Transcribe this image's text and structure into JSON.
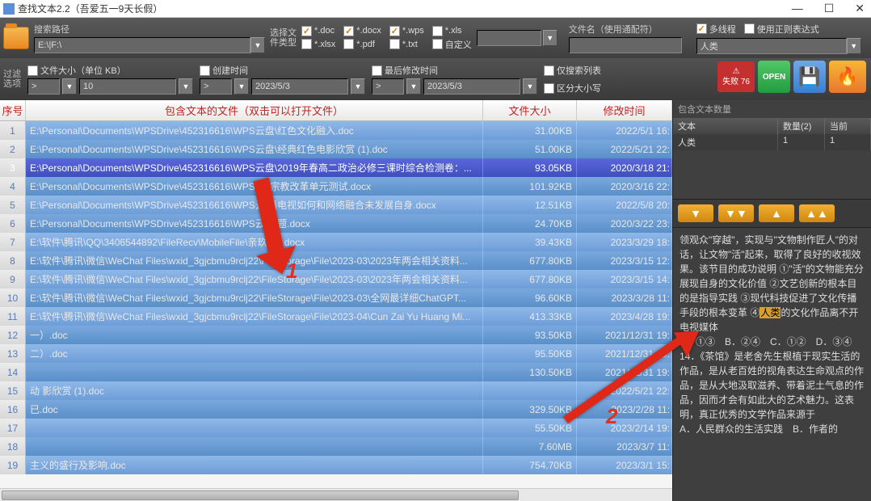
{
  "window": {
    "title": "查找文本2.2（吾爱五一9天长假）"
  },
  "toolbar": {
    "path_label": "搜索路径",
    "path_value": "E:\\|F:\\",
    "filetype_label": "选择文\n件类型",
    "filetypes": [
      {
        "label": "*.doc",
        "checked": true
      },
      {
        "label": "*.docx",
        "checked": true
      },
      {
        "label": "*.wps",
        "checked": true
      },
      {
        "label": "*.xls",
        "checked": false
      },
      {
        "label": "*.xlsx",
        "checked": false
      },
      {
        "label": "*.pdf",
        "checked": false
      },
      {
        "label": "*.txt",
        "checked": false
      },
      {
        "label": "自定义",
        "checked": false
      }
    ],
    "custom_ext": "",
    "filename_label": "文件名（使用通配符）",
    "filename_value": "",
    "multithread": {
      "label": "多线程",
      "checked": true
    },
    "regex": {
      "label": "使用正则表达式",
      "checked": false
    },
    "keyword": "人类"
  },
  "filters": {
    "side_label": "过滤\n选项",
    "size": {
      "label": "文件大小（单位 KB）",
      "checked": false,
      "op": ">",
      "val": "10"
    },
    "ctime": {
      "label": "创建时间",
      "checked": false,
      "op": ">",
      "val": "2023/5/3"
    },
    "mtime": {
      "label": "最后修改时间",
      "checked": false,
      "op": ">",
      "val": "2023/5/3"
    },
    "listonly": {
      "label": "仅搜索列表",
      "checked": false
    },
    "casesen": {
      "label": "区分大小写",
      "checked": false
    },
    "fail_label": "失败 76",
    "open_label": "OPEN"
  },
  "grid": {
    "headers": {
      "idx": "序号",
      "file": "包含文本的文件（双击可以打开文件）",
      "size": "文件大小",
      "date": "修改时间"
    },
    "rows": [
      {
        "i": "1",
        "f": "E:\\Personal\\Documents\\WPSDrive\\452316616\\WPS云盘\\红色文化融入.doc",
        "s": "31.00KB",
        "d": "2022/5/1 16:"
      },
      {
        "i": "2",
        "f": "E:\\Personal\\Documents\\WPSDrive\\452316616\\WPS云盘\\经典红色电影欣赏 (1).doc",
        "s": "51.00KB",
        "d": "2022/5/21 22:"
      },
      {
        "i": "3",
        "f": "E:\\Personal\\Documents\\WPSDrive\\452316616\\WPS云盘\\2019年春高二政治必修三课时综合检测卷：...",
        "s": "93.05KB",
        "d": "2020/3/18 21:",
        "sel": true
      },
      {
        "i": "4",
        "f": "E:\\Personal\\Documents\\WPSDrive\\452316616\\WPS云    \\宗教改革单元测试.docx",
        "s": "101.92KB",
        "d": "2020/3/16 22:"
      },
      {
        "i": "5",
        "f": "E:\\Personal\\Documents\\WPSDrive\\452316616\\WPS云       播电视如何和网络融合未发展自身.docx",
        "s": "12.51KB",
        "d": "2022/5/8 20:"
      },
      {
        "i": "6",
        "f": "E:\\Personal\\Documents\\WPSDrive\\452316616\\WPS云          试题.docx",
        "s": "24.70KB",
        "d": "2020/3/22 23:"
      },
      {
        "i": "7",
        "f": "E:\\软件\\腾讯\\QQ\\3406544892\\FileRecv\\MobileFile\\亲玖         (1).docx",
        "s": "39.43KB",
        "d": "2023/3/29 18:"
      },
      {
        "i": "8",
        "f": "E:\\软件\\腾讯\\微信\\WeChat Files\\wxid_3gjcbmu9rclj22\\FileStorage\\File\\2023-03\\2023年两会相关资料...",
        "s": "677.80KB",
        "d": "2023/3/15 12:"
      },
      {
        "i": "9",
        "f": "E:\\软件\\腾讯\\微信\\WeChat Files\\wxid_3gjcbmu9rclj22\\FileStorage\\File\\2023-03\\2023年两会相关资料...",
        "s": "677.80KB",
        "d": "2023/3/15 14:"
      },
      {
        "i": "10",
        "f": "E:\\软件\\腾讯\\微信\\WeChat Files\\wxid_3gjcbmu9rclj22\\FileStorage\\File\\2023-03\\全网最详细ChatGPT...",
        "s": "96.60KB",
        "d": "2023/3/28 11:"
      },
      {
        "i": "11",
        "f": "E:\\软件\\腾讯\\微信\\WeChat Files\\wxid_3gjcbmu9rclj22\\FileStorage\\File\\2023-04\\Cun Zai Yu Huang Mi...",
        "s": "413.33KB",
        "d": "2023/4/28 19:"
      },
      {
        "i": "12",
        "f": "                                                               一）.doc",
        "s": "93.50KB",
        "d": "2021/12/31 19:"
      },
      {
        "i": "13",
        "f": "                                                               二）.doc",
        "s": "95.50KB",
        "d": "2021/12/31 19:"
      },
      {
        "i": "14",
        "f": "",
        "s": "130.50KB",
        "d": "2021/12/31 19:"
      },
      {
        "i": "15",
        "f": "                                                       动                           影欣赏 (1).doc",
        "s": "",
        "d": "2022/5/21 22:"
      },
      {
        "i": "16",
        "f": "                                                     已.doc",
        "s": "329.50KB",
        "d": "2023/2/28 11:"
      },
      {
        "i": "17",
        "f": "",
        "s": "55.50KB",
        "d": "2023/2/14 19:"
      },
      {
        "i": "18",
        "f": "",
        "s": "7.60MB",
        "d": "2023/3/7 11:"
      },
      {
        "i": "19",
        "f": "                                                     主义的盛行及影响.doc",
        "s": "754.70KB",
        "d": "2023/3/1 15:"
      }
    ]
  },
  "rightpane": {
    "title": "包含文本数量",
    "headers": {
      "text": "文本",
      "count": "数量(2)",
      "current": "当前"
    },
    "row": {
      "text": "人类",
      "count": "1",
      "current": "1"
    },
    "preview": "领观众\"穿越\"，实现与\"文物制作匠人\"的对话，让文物\"活\"起来，取得了良好的收视效果。该节目的成功说明 ①\"活\"的文物能充分展现自身的文化价值 ②文艺创新的根本目的是指导实践 ③现代科技促进了文化传播手段的根本变革 ④|HL|人类|/HL|的文化作品离不开电视媒体\nA．①③　B．②④　C．①②　D．③④\n14．《茶馆》是老舍先生根植于现实生活的作品，是从老百姓的视角表达生命观点的作品，是从大地汲取滋养、带着泥土气息的作品，因而才会有如此大的艺术魅力。这表明，真正优秀的文学作品来源于\nA．人民群众的生活实践　B．作者的"
  },
  "annotations": {
    "n1": "1",
    "n2": "2"
  }
}
